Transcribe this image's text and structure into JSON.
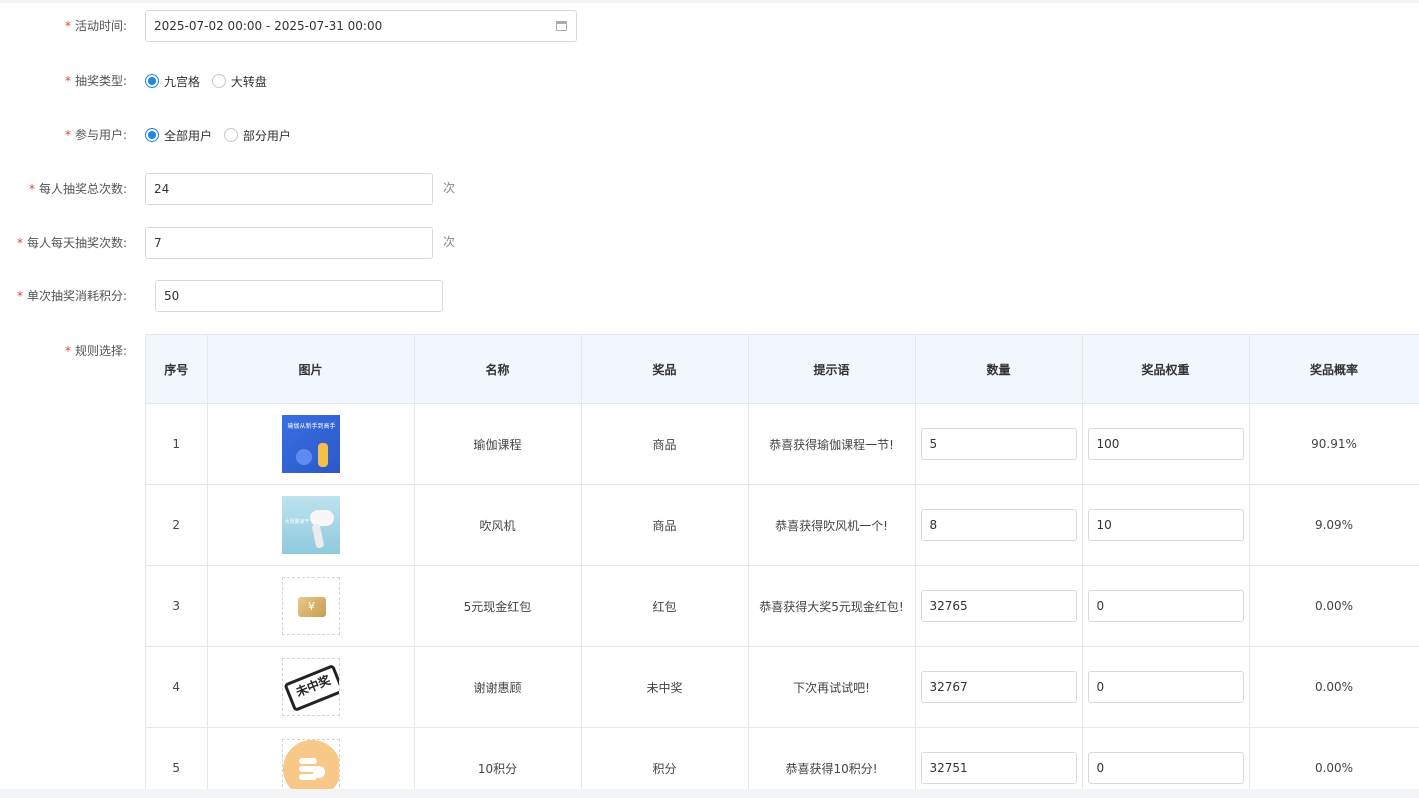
{
  "form": {
    "required_mark": "*",
    "activity_time": {
      "label": "活动时间:",
      "value": "2025-07-02 00:00 - 2025-07-31 00:00"
    },
    "lottery_type": {
      "label": "抽奖类型:",
      "options": [
        "九宫格",
        "大转盘"
      ],
      "selected": "九宫格"
    },
    "participants": {
      "label": "参与用户:",
      "options": [
        "全部用户",
        "部分用户"
      ],
      "selected": "全部用户"
    },
    "total_draws": {
      "label": "每人抽奖总次数:",
      "value": "24",
      "unit": "次"
    },
    "daily_draws": {
      "label": "每人每天抽奖次数:",
      "value": "7",
      "unit": "次"
    },
    "points_cost": {
      "label": "单次抽奖消耗积分:",
      "value": "50"
    },
    "rules": {
      "label": "规则选择:"
    }
  },
  "table": {
    "headers": [
      "序号",
      "图片",
      "名称",
      "奖品",
      "提示语",
      "数量",
      "奖品权重",
      "奖品概率"
    ],
    "rows": [
      {
        "index": "1",
        "image": "yoga-course-image",
        "name": "瑜伽课程",
        "prize": "商品",
        "tip": "恭喜获得瑜伽课程一节!",
        "qty": "5",
        "weight": "100",
        "prob": "90.91%"
      },
      {
        "index": "2",
        "image": "hair-dryer-image",
        "name": "吹风机",
        "prize": "商品",
        "tip": "恭喜获得吹风机一个!",
        "qty": "8",
        "weight": "10",
        "prob": "9.09%"
      },
      {
        "index": "3",
        "image": "red-packet-image",
        "name": "5元现金红包",
        "prize": "红包",
        "tip": "恭喜获得大奖5元现金红包!",
        "qty": "32765",
        "weight": "0",
        "prob": "0.00%"
      },
      {
        "index": "4",
        "image": "no-prize-stamp-image",
        "name": "谢谢惠顾",
        "prize": "未中奖",
        "tip": "下次再试试吧!",
        "qty": "32767",
        "weight": "0",
        "prob": "0.00%"
      },
      {
        "index": "5",
        "image": "points-coin-image",
        "name": "10积分",
        "prize": "积分",
        "tip": "恭喜获得10积分!",
        "qty": "32751",
        "weight": "0",
        "prob": "0.00%"
      }
    ],
    "image_text": {
      "yoga": "瑜伽从新手到高手",
      "dryer": "大风量速干",
      "red_packet_symbol": "¥",
      "stamp": "未中奖"
    }
  },
  "colors": {
    "accent": "#1e88e5",
    "required": "#e23d3d",
    "header_bg": "#f2f6fd"
  }
}
